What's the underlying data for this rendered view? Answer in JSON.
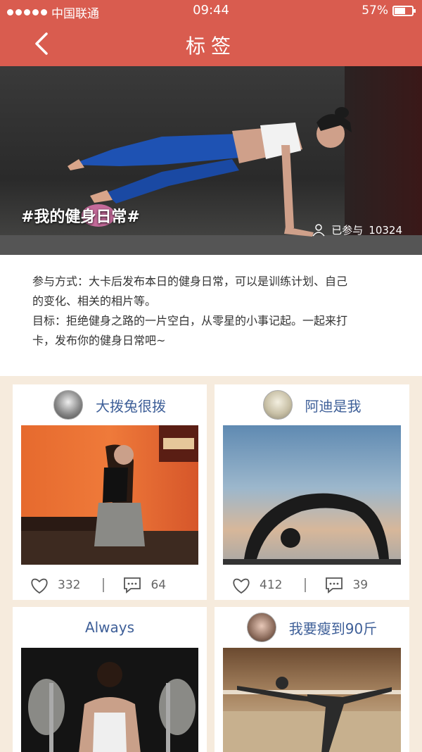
{
  "status": {
    "carrier": "中国联通",
    "time": "09:44",
    "battery": "57%"
  },
  "nav": {
    "title": "标签"
  },
  "banner": {
    "tag": "#我的健身日常#",
    "participants_label": "已参与",
    "participants_count": "10324"
  },
  "description": {
    "line1": "参与方式：大卡后发布本日的健身日常，可以是训练计划、自己",
    "line2": "的变化、相关的相片等。",
    "line3": "目标：拒绝健身之路的一片空白，从零星的小事记起。一起来打",
    "line4": "卡，发布你的健身日常吧~"
  },
  "posts": [
    {
      "user": "大拨兔很拨",
      "likes": "332",
      "comments": "64"
    },
    {
      "user": "阿迪是我",
      "likes": "412",
      "comments": "39"
    },
    {
      "user": "Always"
    },
    {
      "user": "我要瘦到90斤"
    }
  ]
}
